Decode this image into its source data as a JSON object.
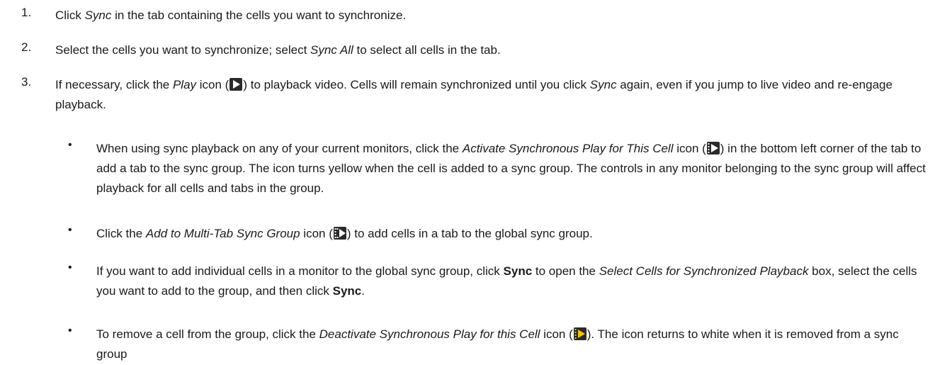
{
  "steps": [
    {
      "number": "1.",
      "parts": [
        "Click ",
        "Sync",
        " in the tab containing the cells you want to synchronize."
      ]
    },
    {
      "number": "2.",
      "parts": [
        "Select the cells you want to synchronize; select ",
        "Sync All",
        " to select all cells in the tab."
      ]
    },
    {
      "number": "3.",
      "parts": [
        "If necessary, click the ",
        "Play",
        " icon (",
        ") to playback video. Cells will remain synchronized until you click ",
        "Sync",
        " again, even if you jump to live video and re-engage playback."
      ]
    }
  ],
  "bullets": [
    {
      "parts": [
        "When using sync playback on any of your current monitors, click the ",
        "Activate Synchronous Play for This Cell",
        " icon (",
        ") in the bottom left corner of the tab to add a tab to the sync group. The icon turns yellow when the cell is added to a sync group. The controls in any monitor belonging to the sync group will affect playback for all cells and tabs in the group."
      ]
    },
    {
      "parts": [
        "Click the ",
        "Add to Multi-Tab Sync Group",
        " icon (",
        ") to add cells in a tab to the global sync group."
      ]
    },
    {
      "parts": [
        "If you want to add individual cells in a monitor to the global sync group, click ",
        "Sync",
        " to open the ",
        "Select Cells for Synchronized Playback",
        " box, select the cells you want to add to the group, and then click ",
        "Sync",
        "."
      ]
    },
    {
      "parts": [
        "To remove a cell from the group, click the ",
        "Deactivate Synchronous Play for this Cell",
        " icon (",
        "). The icon returns to white when it is removed from a sync group"
      ]
    }
  ],
  "bullet_char": "•",
  "icons": {
    "play": {
      "name": "play-icon",
      "bg": "#2a2a2a",
      "fg": "#ffffff"
    },
    "activate_sync": {
      "name": "sync-play-icon",
      "bg": "#2a2a2a",
      "fg": "#ffffff"
    },
    "multi_tab": {
      "name": "multi-tab-sync-icon",
      "bg": "#2a2a2a",
      "fg": "#ffffff"
    },
    "deactivate_sync": {
      "name": "sync-play-active-icon",
      "bg": "#2a2a2a",
      "fg": "#f2c200"
    }
  }
}
